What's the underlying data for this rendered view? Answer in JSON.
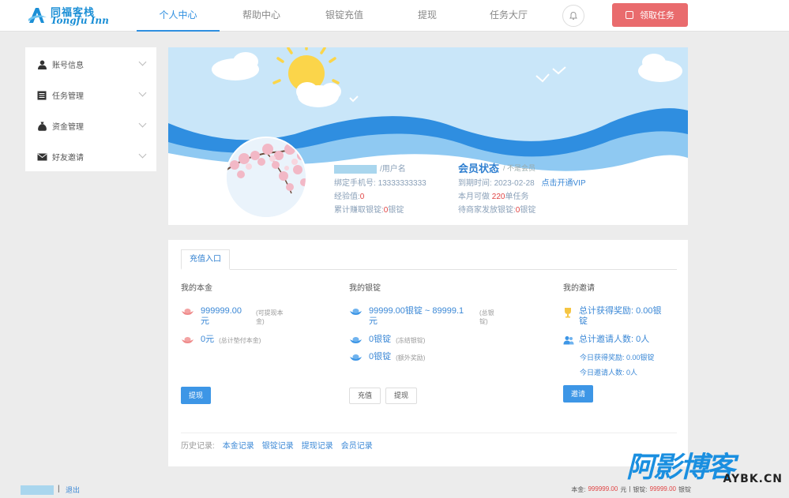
{
  "header": {
    "logo_cn": "同福客栈",
    "logo_en": "Tongfu Inn",
    "nav": [
      {
        "label": "个人中心",
        "active": true
      },
      {
        "label": "帮助中心",
        "active": false
      },
      {
        "label": "银锭充值",
        "active": false
      },
      {
        "label": "提现",
        "active": false
      },
      {
        "label": "任务大厅",
        "active": false
      }
    ],
    "claim_button": "领取任务",
    "accent": "#2f8fe0",
    "claim_color": "#e96b6d"
  },
  "sidebar": {
    "items": [
      {
        "label": "账号信息",
        "icon": "user-icon"
      },
      {
        "label": "任务管理",
        "icon": "list-icon"
      },
      {
        "label": "资金管理",
        "icon": "money-bag-icon"
      },
      {
        "label": "好友邀请",
        "icon": "mail-icon"
      }
    ]
  },
  "profile": {
    "username_suffix": "/用户名",
    "phone_label": "绑定手机号:",
    "phone": "13333333333",
    "exp_label": "经验值:",
    "exp_value": "0",
    "earned_label": "累计赚取银锭:",
    "earned_value": "0",
    "earned_unit": "银锭",
    "member_title": "会员状态",
    "member_status": "/ 不是会员",
    "expire_label": "到期时间:",
    "expire_date": "2023-02-28",
    "renew_link": "点击开通VIP",
    "month_label": "本月可做",
    "month_value": "220",
    "month_unit": "单任务",
    "pending_label": "待商家发放银锭:",
    "pending_value": "0",
    "pending_unit": "银锭"
  },
  "panel": {
    "tab": "充值入口",
    "principal": {
      "title": "我的本金",
      "amount": "999999.00",
      "amount_unit": "元",
      "amount_note": "(可提现本金)",
      "total": "0元",
      "total_note": "(总计垫付本金)",
      "button": "提现"
    },
    "ingots": {
      "title": "我的银锭",
      "amount": "99999.00银锭 ~ 89999.1",
      "amount_unit": "元",
      "amount_note": "(总银锭)",
      "frozen": "0银锭",
      "frozen_note": "(冻结银锭)",
      "extra": "0银锭",
      "extra_note": "(额外奖励)",
      "button_recharge": "充值",
      "button_withdraw": "提现"
    },
    "invite": {
      "title": "我的邀请",
      "reward": "总计获得奖励: 0.00银",
      "reward_unit": "锭",
      "people": "总计邀请人数: 0人",
      "today_reward": "今日获得奖励: 0.00银锭",
      "today_people": "今日邀请人数: 0人",
      "button": "邀请"
    },
    "history_label": "历史记录:",
    "history_links": [
      "本金记录",
      "银锭记录",
      "提现记录",
      "会员记录"
    ]
  },
  "footer": {
    "separator": "|",
    "exit": "退出",
    "principal_label": "本金:",
    "principal_value": "999999.00",
    "principal_unit": "元",
    "ingot_label": "银锭:",
    "ingot_value": "99999.00",
    "ingot_unit": "银锭"
  },
  "watermark": {
    "cn": "阿影博客",
    "en": "AYBK.CN"
  }
}
